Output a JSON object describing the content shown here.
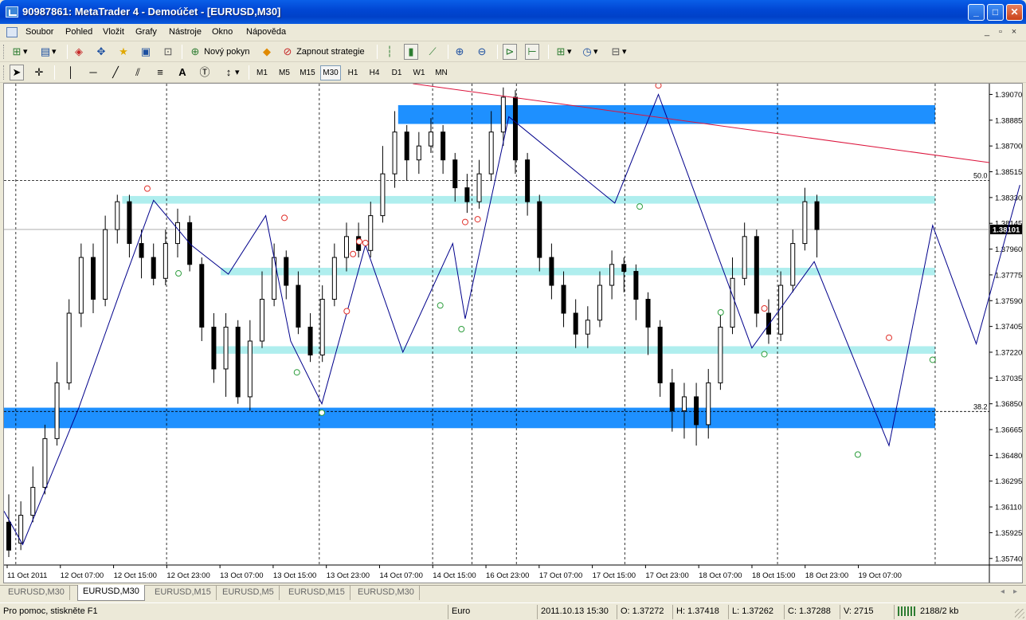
{
  "window": {
    "title": "90987861: MetaTrader 4 - Demoúčet - [EURUSD,M30]",
    "btn_min": "_",
    "btn_max": "□",
    "btn_close": "✕"
  },
  "menu": {
    "items": [
      "Soubor",
      "Pohled",
      "Vložit",
      "Grafy",
      "Nástroje",
      "Okno",
      "Nápověda"
    ],
    "mdi": [
      "_",
      "▫",
      "×"
    ]
  },
  "toolbar": {
    "new_order": "Nový pokyn",
    "autotrading": "Zapnout strategie"
  },
  "timeframes": [
    "M1",
    "M5",
    "M15",
    "M30",
    "H1",
    "H4",
    "D1",
    "W1",
    "MN"
  ],
  "active_timeframe": "M30",
  "chart_data": {
    "type": "candlestick",
    "symbol": "EURUSD",
    "period": "M30",
    "ylim": [
      1.35693,
      1.39147
    ],
    "price_ticks": [
      "1.39070",
      "1.38885",
      "1.38700",
      "1.38515",
      "1.38330",
      "1.38145",
      "1.37960",
      "1.37775",
      "1.37590",
      "1.37405",
      "1.37220",
      "1.37035",
      "1.36850",
      "1.36665",
      "1.36480",
      "1.36295",
      "1.36110",
      "1.35925",
      "1.35740"
    ],
    "time_ticks": [
      "11 Oct 2011",
      "12 Oct 07:00",
      "12 Oct 15:00",
      "12 Oct 23:00",
      "13 Oct 07:00",
      "13 Oct 15:00",
      "13 Oct 23:00",
      "14 Oct 07:00",
      "14 Oct 15:00",
      "16 Oct 23:00",
      "17 Oct 07:00",
      "17 Oct 15:00",
      "17 Oct 23:00",
      "18 Oct 07:00",
      "18 Oct 15:00",
      "18 Oct 23:00",
      "19 Oct 07:00"
    ],
    "current_price": "1.38101",
    "fib_levels": [
      {
        "label": "50.0",
        "price": 1.38452
      },
      {
        "label": "38.2",
        "price": 1.36795
      }
    ],
    "zones": [
      {
        "type": "supply",
        "price_top": 1.38993,
        "price_bottom": 1.38858,
        "x_start": 0.4,
        "x_end": 0.945
      },
      {
        "type": "support",
        "price_top": 1.38341,
        "price_bottom": 1.38286,
        "x_start": 0.12,
        "x_end": 0.945
      },
      {
        "type": "support",
        "price_top": 1.37826,
        "price_bottom": 1.37772,
        "x_start": 0.22,
        "x_end": 0.945
      },
      {
        "type": "support",
        "price_top": 1.37263,
        "price_bottom": 1.37209,
        "x_start": 0.215,
        "x_end": 0.945
      },
      {
        "type": "demand",
        "price_top": 1.36822,
        "price_bottom": 1.36675,
        "x_start": 0.0,
        "x_end": 0.945
      }
    ],
    "trendline": {
      "from": [
        0.415,
        1.39147
      ],
      "to": [
        1.0,
        1.38581
      ]
    },
    "zigzag": [
      [
        0.0,
        1.3608
      ],
      [
        0.015,
        1.3584
      ],
      [
        0.06,
        1.3682
      ],
      [
        0.095,
        1.377
      ],
      [
        0.12,
        1.3831
      ],
      [
        0.15,
        1.3799
      ],
      [
        0.18,
        1.3778
      ],
      [
        0.21,
        1.382
      ],
      [
        0.23,
        1.373
      ],
      [
        0.255,
        1.3685
      ],
      [
        0.29,
        1.3799
      ],
      [
        0.32,
        1.3722
      ],
      [
        0.36,
        1.38
      ],
      [
        0.37,
        1.3746
      ],
      [
        0.405,
        1.3891
      ],
      [
        0.49,
        1.3829
      ],
      [
        0.525,
        1.3907
      ],
      [
        0.6,
        1.3725
      ],
      [
        0.65,
        1.3787
      ],
      [
        0.71,
        1.3655
      ],
      [
        0.745,
        1.3813
      ],
      [
        0.78,
        1.3728
      ],
      [
        0.815,
        1.3842
      ]
    ],
    "fractals_up": [
      [
        0.115,
        1.3836
      ],
      [
        0.225,
        1.3815
      ],
      [
        0.275,
        1.3748
      ],
      [
        0.28,
        1.3789
      ],
      [
        0.285,
        1.3798
      ],
      [
        0.29,
        1.3797
      ],
      [
        0.37,
        1.3812
      ],
      [
        0.38,
        1.3814
      ],
      [
        0.525,
        1.391
      ],
      [
        0.61,
        1.375
      ],
      [
        0.71,
        1.3729
      ],
      [
        0.82,
        1.3847
      ]
    ],
    "fractals_down": [
      [
        0.14,
        1.3782
      ],
      [
        0.235,
        1.3711
      ],
      [
        0.255,
        1.3682
      ],
      [
        0.35,
        1.3759
      ],
      [
        0.367,
        1.3742
      ],
      [
        0.51,
        1.383
      ],
      [
        0.575,
        1.3754
      ],
      [
        0.61,
        1.3724
      ],
      [
        0.685,
        1.3652
      ],
      [
        0.745,
        1.372
      ]
    ],
    "candles": [
      [
        1.36,
        1.358,
        1.362,
        1.3575
      ],
      [
        1.3585,
        1.3605,
        1.3615,
        1.358
      ],
      [
        1.3605,
        1.3625,
        1.364,
        1.36
      ],
      [
        1.3625,
        1.366,
        1.367,
        1.362
      ],
      [
        1.366,
        1.37,
        1.3715,
        1.3655
      ],
      [
        1.37,
        1.375,
        1.376,
        1.3695
      ],
      [
        1.375,
        1.379,
        1.38,
        1.374
      ],
      [
        1.379,
        1.376,
        1.38,
        1.375
      ],
      [
        1.376,
        1.381,
        1.382,
        1.3755
      ],
      [
        1.381,
        1.383,
        1.3835,
        1.38
      ],
      [
        1.383,
        1.38,
        1.3835,
        1.379
      ],
      [
        1.38,
        1.379,
        1.381,
        1.3775
      ],
      [
        1.379,
        1.3775,
        1.38,
        1.377
      ],
      [
        1.3775,
        1.38,
        1.381,
        1.377
      ],
      [
        1.38,
        1.3815,
        1.3825,
        1.379
      ],
      [
        1.3815,
        1.3785,
        1.382,
        1.378
      ],
      [
        1.3785,
        1.374,
        1.379,
        1.373
      ],
      [
        1.374,
        1.371,
        1.375,
        1.37
      ],
      [
        1.371,
        1.374,
        1.375,
        1.369
      ],
      [
        1.374,
        1.369,
        1.3745,
        1.3685
      ],
      [
        1.369,
        1.373,
        1.3745,
        1.368
      ],
      [
        1.373,
        1.376,
        1.378,
        1.3725
      ],
      [
        1.376,
        1.379,
        1.38,
        1.3755
      ],
      [
        1.379,
        1.377,
        1.3795,
        1.376
      ],
      [
        1.377,
        1.374,
        1.378,
        1.3735
      ],
      [
        1.374,
        1.372,
        1.375,
        1.3715
      ],
      [
        1.372,
        1.376,
        1.377,
        1.3715
      ],
      [
        1.376,
        1.379,
        1.38,
        1.3755
      ],
      [
        1.379,
        1.3805,
        1.3815,
        1.378
      ],
      [
        1.3805,
        1.3795,
        1.3815,
        1.379
      ],
      [
        1.3795,
        1.382,
        1.383,
        1.379
      ],
      [
        1.382,
        1.385,
        1.387,
        1.3815
      ],
      [
        1.385,
        1.388,
        1.3895,
        1.384
      ],
      [
        1.388,
        1.386,
        1.3885,
        1.3845
      ],
      [
        1.386,
        1.387,
        1.388,
        1.385
      ],
      [
        1.387,
        1.388,
        1.389,
        1.3865
      ],
      [
        1.388,
        1.386,
        1.3885,
        1.385
      ],
      [
        1.386,
        1.384,
        1.3865,
        1.383
      ],
      [
        1.384,
        1.383,
        1.385,
        1.3822
      ],
      [
        1.383,
        1.385,
        1.386,
        1.3825
      ],
      [
        1.385,
        1.388,
        1.3895,
        1.3845
      ],
      [
        1.388,
        1.3905,
        1.3912,
        1.387
      ],
      [
        1.3905,
        1.386,
        1.391,
        1.385
      ],
      [
        1.386,
        1.383,
        1.3865,
        1.382
      ],
      [
        1.383,
        1.379,
        1.3835,
        1.378
      ],
      [
        1.379,
        1.377,
        1.38,
        1.376
      ],
      [
        1.377,
        1.375,
        1.378,
        1.374
      ],
      [
        1.375,
        1.3735,
        1.376,
        1.3725
      ],
      [
        1.3735,
        1.3745,
        1.3755,
        1.3725
      ],
      [
        1.3745,
        1.377,
        1.378,
        1.374
      ],
      [
        1.377,
        1.3785,
        1.3795,
        1.376
      ],
      [
        1.3785,
        1.378,
        1.379,
        1.3765
      ],
      [
        1.378,
        1.376,
        1.3785,
        1.3745
      ],
      [
        1.376,
        1.374,
        1.3765,
        1.372
      ],
      [
        1.374,
        1.37,
        1.3745,
        1.369
      ],
      [
        1.37,
        1.368,
        1.371,
        1.3665
      ],
      [
        1.368,
        1.369,
        1.37,
        1.366
      ],
      [
        1.369,
        1.367,
        1.37,
        1.3655
      ],
      [
        1.367,
        1.37,
        1.371,
        1.366
      ],
      [
        1.37,
        1.374,
        1.375,
        1.3695
      ],
      [
        1.374,
        1.3775,
        1.379,
        1.3735
      ],
      [
        1.3775,
        1.3805,
        1.3815,
        1.377
      ],
      [
        1.3805,
        1.375,
        1.381,
        1.374
      ],
      [
        1.375,
        1.3735,
        1.376,
        1.3728
      ],
      [
        1.3735,
        1.377,
        1.378,
        1.373
      ],
      [
        1.377,
        1.38,
        1.381,
        1.3765
      ],
      [
        1.38,
        1.383,
        1.384,
        1.3795
      ],
      [
        1.383,
        1.381,
        1.3835,
        1.379
      ]
    ]
  },
  "tabs": [
    "EURUSD,M30",
    "EURUSD,M30",
    "EURUSD,M15",
    "EURUSD,M5",
    "EURUSD,M15",
    "EURUSD,M30"
  ],
  "active_tab": 1,
  "status": {
    "help": "Pro pomoc, stiskněte F1",
    "profile": "Euro",
    "datetime": "2011.10.13 15:30",
    "open": "O: 1.37272",
    "high": "H: 1.37418",
    "low": "L: 1.37262",
    "close": "C: 1.37288",
    "volume": "V: 2715",
    "traffic": "2188/2 kb"
  },
  "colors": {
    "zone_dark": "#1E90FF",
    "zone_light": "#AFEEEE",
    "trendline": "#DC143C",
    "zigzag": "#00008B",
    "fractal_up": "#E0302A",
    "fractal_down": "#2E9E3E",
    "candle": "#000000"
  }
}
